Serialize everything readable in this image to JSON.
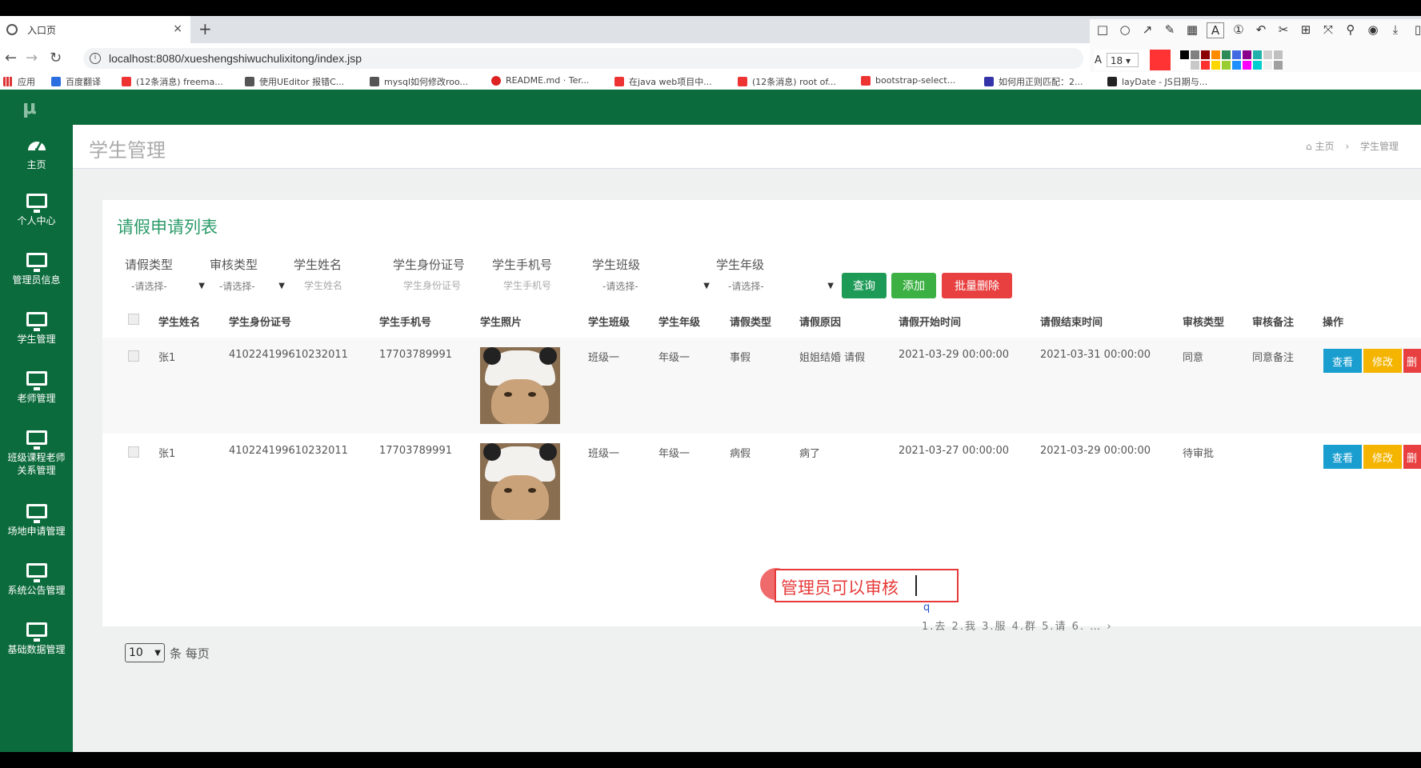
{
  "browser": {
    "tab_title": "入口页",
    "tab_close": "×",
    "new_tab": "+",
    "url": "localhost:8080/xueshengshiwuchulixitong/index.jsp",
    "nav_back": "←",
    "nav_forward": "→",
    "nav_reload": "↻",
    "bookmarks": [
      {
        "label": "应用",
        "color": "#d33"
      },
      {
        "label": "百度翻译",
        "color": "#2a6ee0"
      },
      {
        "label": "(12条消息) freema...",
        "color": "#e33"
      },
      {
        "label": "使用UEditor 报错C...",
        "color": "#555"
      },
      {
        "label": "mysql如何修改roo...",
        "color": "#555"
      },
      {
        "label": "README.md · Ter...",
        "color": "#d22"
      },
      {
        "label": "在java web项目中...",
        "color": "#e33"
      },
      {
        "label": "(12条消息) root of...",
        "color": "#e33"
      },
      {
        "label": "bootstrap-select...",
        "color": "#e33"
      },
      {
        "label": "如何用正则匹配：2...",
        "color": "#33a"
      },
      {
        "label": "layDate - JS日期与...",
        "color": "#222"
      }
    ]
  },
  "annotation_tool": {
    "font_size": "18",
    "current_color": "#ff3333",
    "palette": [
      "#000000",
      "#808080",
      "#8b0000",
      "#ff8c00",
      "#2e8b57",
      "#4169e1",
      "#8b008b",
      "#20b2aa",
      "#d0d0d0",
      "#c0c0c0",
      "#ffffff",
      "#c8c8c8",
      "#ff3030",
      "#ffd700",
      "#9acd32",
      "#1e90ff",
      "#ff00ff",
      "#00ced1",
      "#f0f0f0",
      "#a0a0a0"
    ]
  },
  "app": {
    "logo": "μ",
    "sidebar": [
      {
        "label": "主页",
        "icon": "dashboard-icon"
      },
      {
        "label": "个人中心",
        "icon": "monitor-icon"
      },
      {
        "label": "管理员信息",
        "icon": "monitor-icon"
      },
      {
        "label": "学生管理",
        "icon": "monitor-icon"
      },
      {
        "label": "老师管理",
        "icon": "monitor-icon"
      },
      {
        "label": "班级课程老师关系管理",
        "label_line1": "班级课程老师",
        "label_line2": "关系管理",
        "icon": "monitor-icon"
      },
      {
        "label": "场地申请管理",
        "icon": "monitor-icon"
      },
      {
        "label": "系统公告管理",
        "icon": "monitor-icon"
      },
      {
        "label": "基础数据管理",
        "icon": "monitor-icon"
      }
    ],
    "page_title": "学生管理",
    "breadcrumb": {
      "home": "主页",
      "sep": "›",
      "current": "学生管理"
    },
    "card_title": "请假申请列表",
    "filters": {
      "labels": [
        "请假类型",
        "审核类型",
        "学生姓名",
        "学生身份证号",
        "学生手机号",
        "学生班级",
        "学生年级"
      ],
      "leave_type": "-请选择-",
      "review_type": "-请选择-",
      "name_placeholder": "学生姓名",
      "id_placeholder": "学生身份证号",
      "phone_placeholder": "学生手机号",
      "class": "-请选择-",
      "grade": "-请选择-"
    },
    "buttons": {
      "query": "查询",
      "add": "添加",
      "batch_delete": "批量删除"
    },
    "columns": [
      "学生姓名",
      "学生身份证号",
      "学生手机号",
      "学生照片",
      "学生班级",
      "学生年级",
      "请假类型",
      "请假原因",
      "请假开始时间",
      "请假结束时间",
      "审核类型",
      "审核备注",
      "操作"
    ],
    "rows": [
      {
        "name": "张1",
        "id": "410224199610232011",
        "phone": "17703789991",
        "class": "班级一",
        "grade": "年级一",
        "leave_type": "事假",
        "reason": "姐姐结婚 请假",
        "start": "2021-03-29 00:00:00",
        "end": "2021-03-31 00:00:00",
        "review": "同意",
        "note": "同意备注"
      },
      {
        "name": "张1",
        "id": "410224199610232011",
        "phone": "17703789991",
        "class": "班级一",
        "grade": "年级一",
        "leave_type": "病假",
        "reason": "病了",
        "start": "2021-03-27 00:00:00",
        "end": "2021-03-29 00:00:00",
        "review": "待审批",
        "note": ""
      }
    ],
    "row_actions": {
      "view": "查看",
      "edit": "修改",
      "delete": "删"
    },
    "pager": {
      "size": "10",
      "suffix": "条 每页"
    }
  },
  "overlay": {
    "annotation_text": "管理员可以审核",
    "ime_input": "q",
    "ime_candidates": "1.去 2.我 3.服 4.群 5.请 6.  …  ›"
  }
}
